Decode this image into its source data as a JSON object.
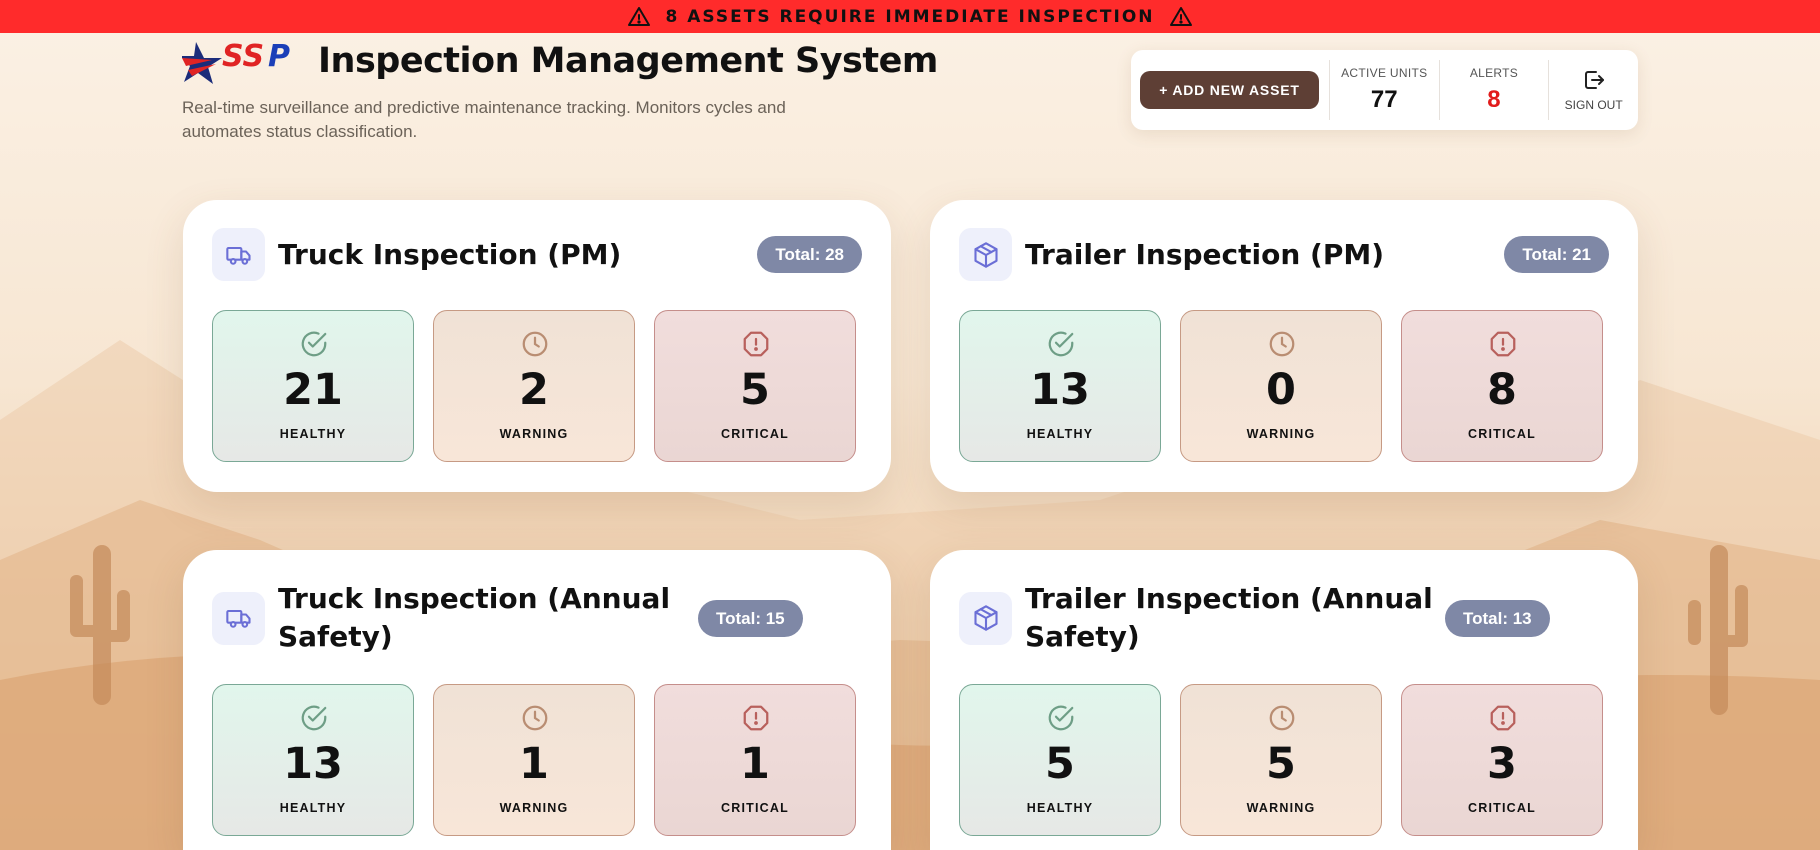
{
  "banner": {
    "text": "8 ASSETS REQUIRE IMMEDIATE INSPECTION"
  },
  "header": {
    "logo_text": "SSP",
    "title": "Inspection Management System",
    "subtitle": "Real-time surveillance and predictive maintenance tracking. Monitors cycles and automates status classification."
  },
  "status_panel": {
    "add_button": "+ ADD NEW ASSET",
    "active_units_label": "ACTIVE UNITS",
    "active_units_value": "77",
    "alerts_label": "ALERTS",
    "alerts_value": "8",
    "sign_out_label": "SIGN OUT"
  },
  "cards": [
    {
      "title": "Truck Inspection (PM)",
      "icon": "truck-icon",
      "total": "Total: 28",
      "healthy": "21",
      "warning": "2",
      "critical": "5"
    },
    {
      "title": "Trailer Inspection (PM)",
      "icon": "package-icon",
      "total": "Total: 21",
      "healthy": "13",
      "warning": "0",
      "critical": "8"
    },
    {
      "title": "Truck Inspection (Annual Safety)",
      "icon": "truck-icon",
      "total": "Total: 15",
      "healthy": "13",
      "warning": "1",
      "critical": "1"
    },
    {
      "title": "Trailer Inspection (Annual Safety)",
      "icon": "package-icon",
      "total": "Total: 13",
      "healthy": "5",
      "warning": "5",
      "critical": "3"
    }
  ],
  "labels": {
    "healthy": "HEALTHY",
    "warning": "WARNING",
    "critical": "CRITICAL"
  },
  "colors": {
    "banner": "#ff2b2b",
    "add_button": "#5e3f35",
    "alert": "#e21b1b",
    "badge": "#7f88a6",
    "healthy": "#6e9e86",
    "warning": "#b98d72",
    "critical": "#b8605c"
  }
}
